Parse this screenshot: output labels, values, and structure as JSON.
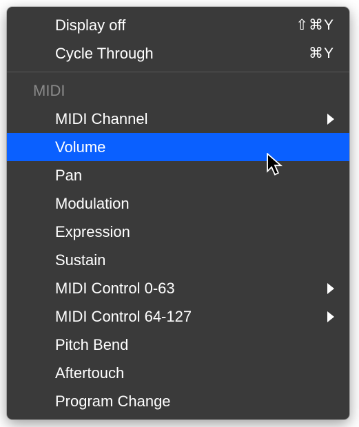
{
  "top_section": {
    "items": [
      {
        "label": "Display off",
        "shortcut": "⇧⌘Y",
        "hasSubmenu": false
      },
      {
        "label": "Cycle Through",
        "shortcut": "⌘Y",
        "hasSubmenu": false
      }
    ]
  },
  "midi_section": {
    "header": "MIDI",
    "items": [
      {
        "label": "MIDI Channel",
        "shortcut": "",
        "hasSubmenu": true,
        "highlighted": false
      },
      {
        "label": "Volume",
        "shortcut": "",
        "hasSubmenu": false,
        "highlighted": true
      },
      {
        "label": "Pan",
        "shortcut": "",
        "hasSubmenu": false,
        "highlighted": false
      },
      {
        "label": "Modulation",
        "shortcut": "",
        "hasSubmenu": false,
        "highlighted": false
      },
      {
        "label": "Expression",
        "shortcut": "",
        "hasSubmenu": false,
        "highlighted": false
      },
      {
        "label": "Sustain",
        "shortcut": "",
        "hasSubmenu": false,
        "highlighted": false
      },
      {
        "label": "MIDI Control 0-63",
        "shortcut": "",
        "hasSubmenu": true,
        "highlighted": false
      },
      {
        "label": "MIDI Control 64-127",
        "shortcut": "",
        "hasSubmenu": true,
        "highlighted": false
      },
      {
        "label": "Pitch Bend",
        "shortcut": "",
        "hasSubmenu": false,
        "highlighted": false
      },
      {
        "label": "Aftertouch",
        "shortcut": "",
        "hasSubmenu": false,
        "highlighted": false
      },
      {
        "label": "Program Change",
        "shortcut": "",
        "hasSubmenu": false,
        "highlighted": false
      }
    ]
  }
}
